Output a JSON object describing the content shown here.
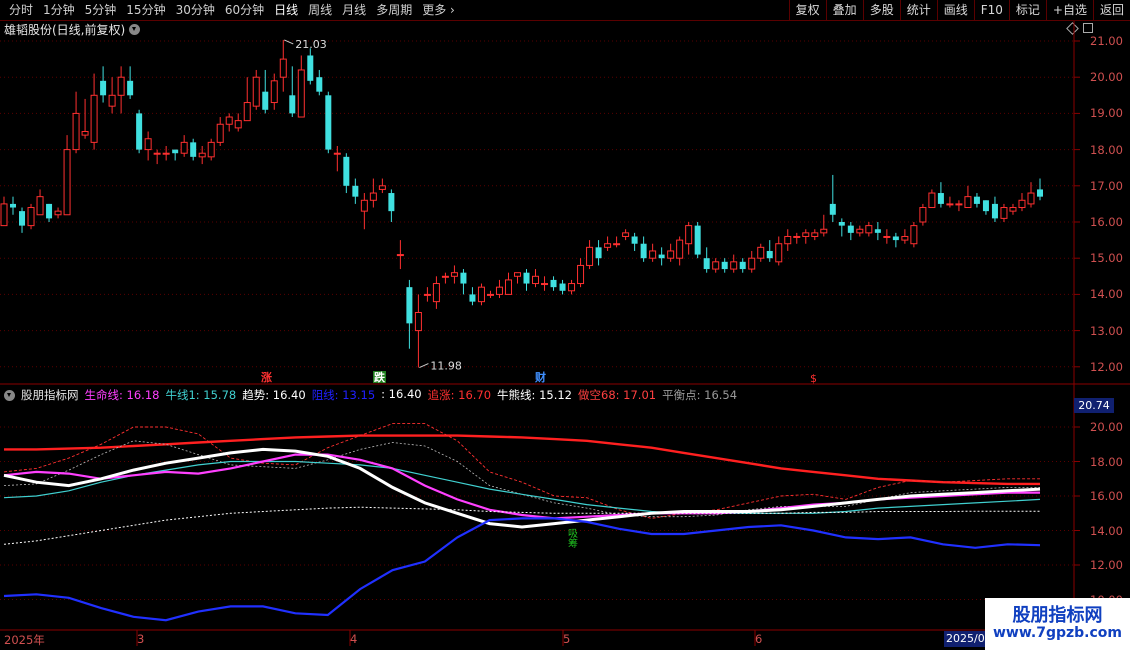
{
  "toolbar": {
    "periods": [
      "分时",
      "1分钟",
      "5分钟",
      "15分钟",
      "30分钟",
      "60分钟",
      "日线",
      "周线",
      "月线",
      "多周期",
      "更多"
    ],
    "active_period": "日线",
    "buttons": [
      "复权",
      "叠加",
      "多股",
      "统计",
      "画线",
      "F10",
      "标记",
      "+自选",
      "返回"
    ]
  },
  "main_title": "雄韬股份(日线,前复权)",
  "price_axis": [
    "21.00",
    "20.00",
    "19.00",
    "18.00",
    "17.00",
    "16.00",
    "15.00",
    "14.00",
    "13.00",
    "12.00"
  ],
  "annotations": {
    "high": "21.03",
    "low": "11.98"
  },
  "signals": {
    "zhang": "涨",
    "die": "跌",
    "cai": "财",
    "s": "$"
  },
  "indicator": {
    "name": "股朋指标网",
    "items": [
      {
        "label": "生命线: 16.18",
        "color": "#ff40ff"
      },
      {
        "label": "牛线1: 15.78",
        "color": "#40d0d0"
      },
      {
        "label": "趋势: 16.40",
        "color": "#ffffff"
      },
      {
        "label": "阻线: 13.15",
        "color": "#2020ff"
      },
      {
        "label": ": 16.40",
        "color": "#ffffff"
      },
      {
        "label": "追涨: 16.70",
        "color": "#ff3030"
      },
      {
        "label": "牛熊线: 15.12",
        "color": "#ffffff"
      },
      {
        "label": "做空68: 17.01",
        "color": "#ff4040"
      },
      {
        "label": "平衡点: 16.54",
        "color": "#999999"
      }
    ],
    "axis": [
      "20.00",
      "18.00",
      "16.00",
      "14.00",
      "12.00",
      "10.00"
    ],
    "current": "20.74",
    "signal_text": "吸筹"
  },
  "dates": [
    "2025年",
    "3",
    "4",
    "5",
    "6"
  ],
  "date_box": "2025/0",
  "watermark": {
    "line1": "股朋指标网",
    "line2": "www.7gpzb.com"
  }
}
